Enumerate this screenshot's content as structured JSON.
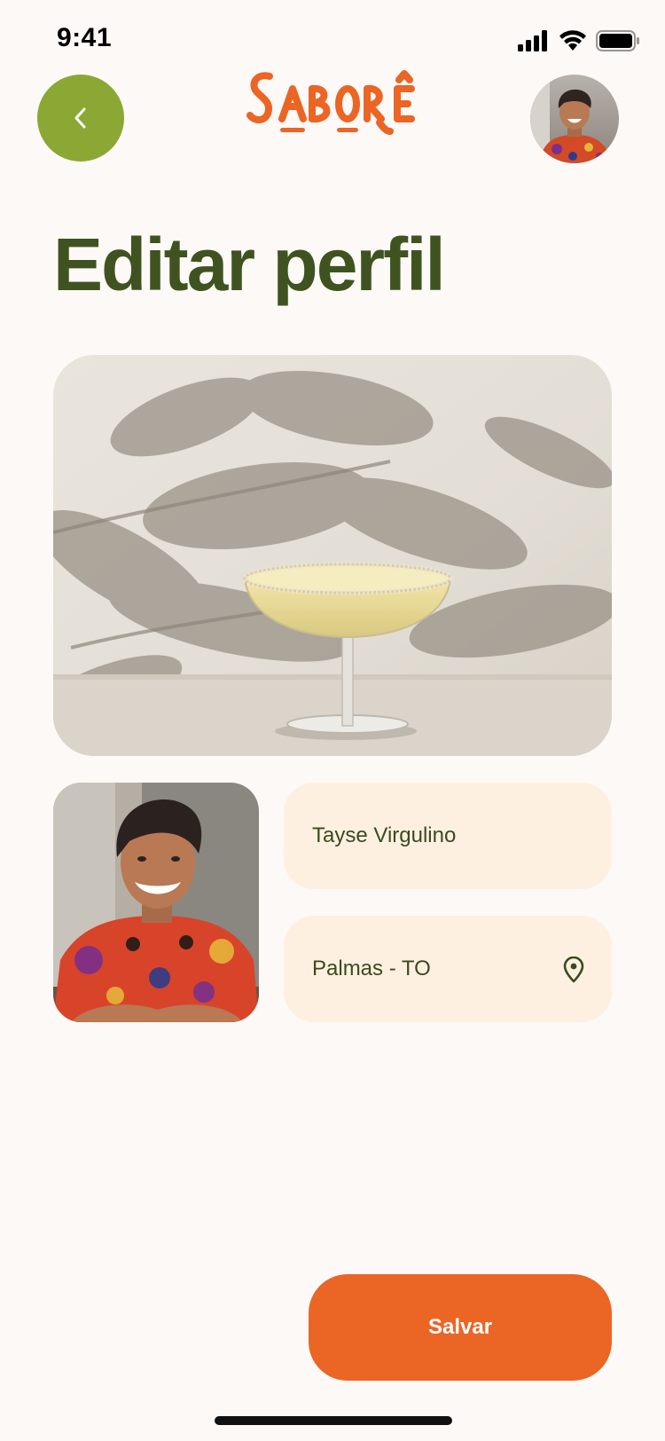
{
  "status_bar": {
    "time": "9:41"
  },
  "header": {
    "back_icon": "chevron-left-icon",
    "logo_text": "SABORÊ",
    "avatar_icon": "user-avatar"
  },
  "page": {
    "title": "Editar perfil"
  },
  "form": {
    "name_value": "Tayse Virgulino",
    "location_value": "Palmas - TO",
    "location_icon": "map-pin-icon"
  },
  "actions": {
    "save_label": "Salvar"
  },
  "colors": {
    "background": "#FDF9F7",
    "accent_green": "#8BA834",
    "title_green": "#3F5320",
    "brand_orange": "#EB6524",
    "field_bg": "#FEF0E0"
  }
}
